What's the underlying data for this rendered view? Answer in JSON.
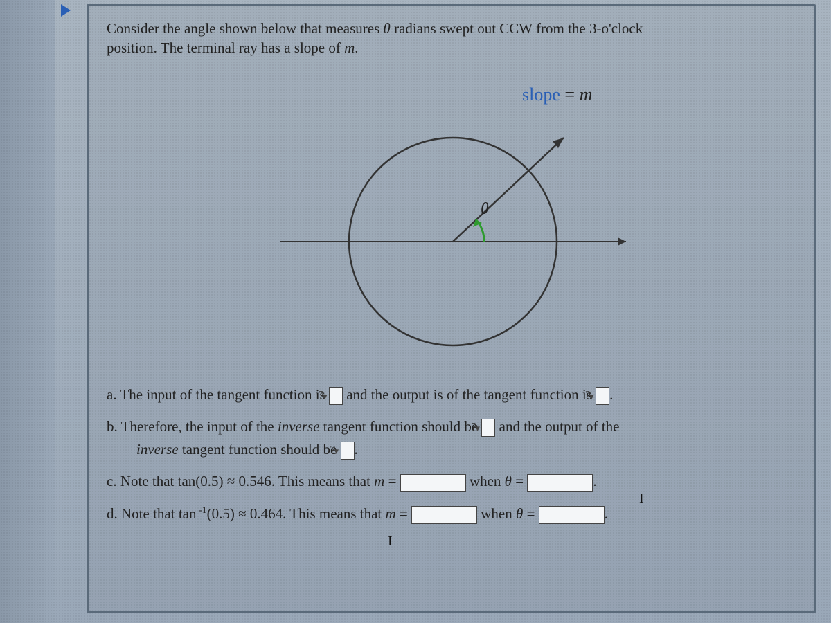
{
  "prompt": {
    "line1_pre": "Consider the angle shown below that measures ",
    "theta": "θ",
    "line1_post": " radians swept out CCW from the 3-o'clock",
    "line2_pre": "position. The terminal ray has a slope of ",
    "m": "m",
    "line2_post": "."
  },
  "diagram": {
    "slope_label_pre": "slope",
    "slope_label_eq": " = ",
    "slope_label_m": "m",
    "theta_label": "θ"
  },
  "dropdown_placeholder": "?",
  "questions": {
    "a": {
      "marker": "a.",
      "t1": " The input of the tangent function is ",
      "t2": " and the output is of the tangent function is ",
      "end": "."
    },
    "b": {
      "marker": "b.",
      "t1": " Therefore, the input of the ",
      "inverse": "inverse",
      "t2": " tangent function should be ",
      "t3": " and the output of the",
      "t4": " tangent function should be ",
      "end": "."
    },
    "c": {
      "marker": "c.",
      "t1": " Note that ",
      "math1": "tan(0.5) ≈ 0.546",
      "t2": ". This means that ",
      "m": "m",
      "eq": " = ",
      "when": " when ",
      "theta": "θ",
      "end": "."
    },
    "d": {
      "marker": "d.",
      "t1": " Note that ",
      "math_tan": "tan",
      "math_exp": " -1",
      "math_rest": "(0.5) ≈ 0.464",
      "t2": ". This means that ",
      "m": "m",
      "eq": " = ",
      "when": " when ",
      "theta": "θ",
      "end": "."
    }
  }
}
